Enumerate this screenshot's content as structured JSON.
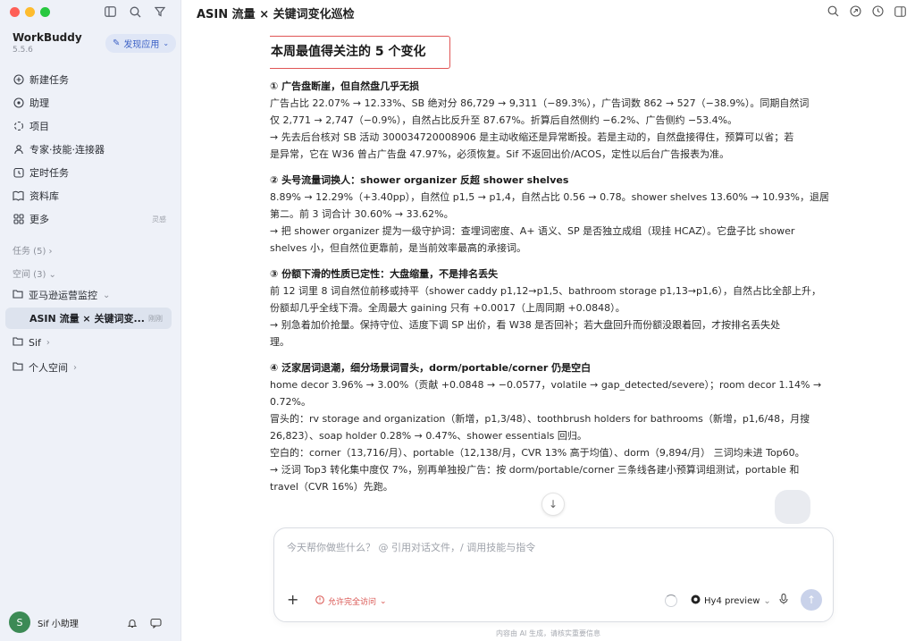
{
  "sidebar": {
    "app_name": "WorkBuddy",
    "version": "5.5.6",
    "discover_label": "发现应用",
    "nav": [
      {
        "label": "新建任务",
        "icon": "plus-circle-icon"
      },
      {
        "label": "助理",
        "icon": "assistant-icon"
      },
      {
        "label": "项目",
        "icon": "project-icon"
      },
      {
        "label": "专家·技能·连接器",
        "icon": "expert-icon"
      },
      {
        "label": "定时任务",
        "icon": "clock-icon"
      },
      {
        "label": "资料库",
        "icon": "book-icon"
      },
      {
        "label": "更多",
        "icon": "grid-icon",
        "hint": "灵感"
      }
    ],
    "tasks_label": "任务 (5)",
    "spaces_label": "空间 (3)",
    "folders": [
      {
        "label": "亚马逊运营监控"
      },
      {
        "label": "Sif"
      },
      {
        "label": "个人空间"
      }
    ],
    "active_chat": {
      "label": "ASIN 流量 × 关键词变...",
      "badge": "刚刚"
    },
    "user_name": "Sif 小助理",
    "avatar_text": "S"
  },
  "main": {
    "title": "ASIN 流量 × 关键词变化巡检",
    "headline": "本周最值得关注的 5 个变化",
    "sections": [
      {
        "title": "① 广告盘断崖，但自然盘几乎无损",
        "lines": [
          "广告占比 22.07% → 12.33%、SB 绝对分 86,729 → 9,311（−89.3%），广告词数 862 → 527（−38.9%）。同期自然词",
          "仅 2,771 → 2,747（−0.9%），自然占比反升至 87.67%。折算后自然侧约 −6.2%、广告侧约 −53.4%。",
          "→ 先去后台核对 SB 活动 300034720008906 是主动收缩还是异常断投。若是主动的，自然盘接得住，预算可以省；若",
          "是异常，它在 W36 曾占广告盘 47.97%，必须恢复。Sif 不返回出价/ACOS，定性以后台广告报表为准。"
        ]
      },
      {
        "title": "② 头号流量词换人：shower organizer 反超 shower shelves",
        "lines": [
          "8.89% → 12.29%（+3.40pp），自然位 p1,5 → p1,4，自然占比 0.56 → 0.78。shower shelves 13.60% → 10.93%，退居",
          "第二。前 3 词合计 30.60% → 33.62%。",
          "→ 把 shower organizer 提为一级守护词：查埋词密度、A+ 语义、SP 是否独立成组（现挂 HCAZ）。它盘子比 shower",
          "shelves 小，但自然位更靠前，是当前效率最高的承接词。"
        ]
      },
      {
        "title": "③ 份额下滑的性质已定性：大盘缩量，不是排名丢失",
        "lines": [
          "前 12 词里 8 词自然位前移或持平（shower caddy p1,12→p1,5、bathroom storage p1,13→p1,6），自然占比全部上升，",
          "份额却几乎全线下滑。全周最大 gaining 只有 +0.0017（上周同期 +0.0848）。",
          "→ 别急着加价抢量。保持守位、适度下调 SP 出价，看 W38 是否回补；若大盘回升而份额没跟着回，才按排名丢失处",
          "理。"
        ]
      },
      {
        "title": "④ 泛家居词退潮，细分场景词冒头，dorm/portable/corner 仍是空白",
        "lines": [
          "home decor 3.96% → 3.00%（贡献 +0.0848 → −0.0577，volatile → gap_detected/severe）；room decor 1.14% →",
          "0.72%。",
          "冒头的：rv storage and organization（新增，p1,3/48）、toothbrush holders for bathrooms（新增，p1,6/48，月搜",
          "26,823）、soap holder 0.28% → 0.47%、shower essentials 回归。",
          "空白的：corner（13,716/月）、portable（12,138/月，CVR 13% 高于均值）、dorm（9,894/月） 三词均未进 Top60。",
          "→ 泛词 Top3 转化集中度仅 7%，别再单独投广告：按 dorm/portable/corner 三条线各建小预算词组测试，portable 和",
          "travel（CVR 16%）先跑。"
        ]
      }
    ],
    "input_placeholder": "今天帮你做些什么？ @ 引用对话文件，/ 调用技能与指令",
    "permission_label": "允许完全访问",
    "model_label": "Hy4 preview",
    "disclaimer": "内容由 AI 生成，请核实重要信息"
  },
  "colors": {
    "accent": "#3d62c6",
    "headline_border": "#e05555",
    "sidebar_bg": "#eef1f8"
  }
}
